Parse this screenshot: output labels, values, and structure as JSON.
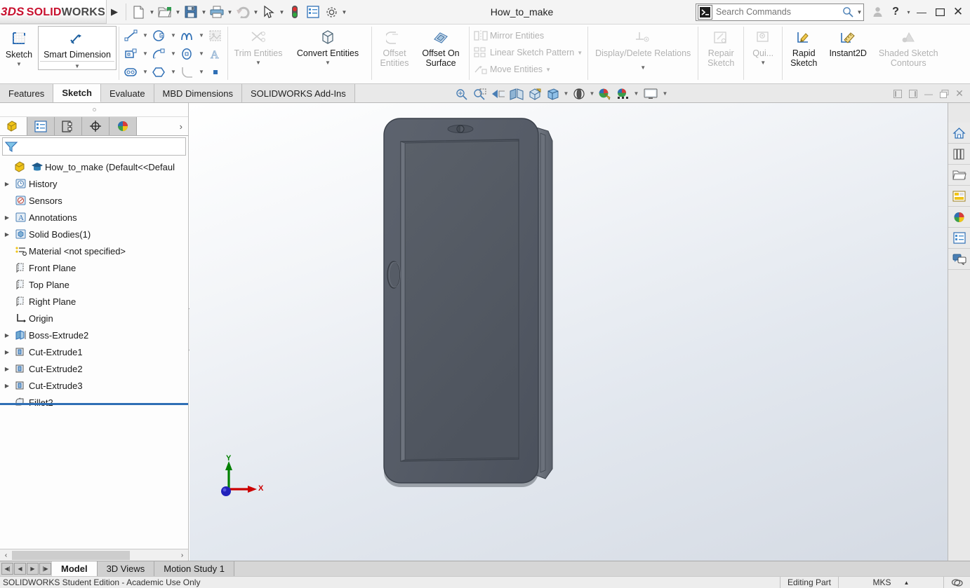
{
  "app": {
    "logo_3ds": "3DS",
    "logo_solid": "SOLID",
    "logo_works": "WORKS",
    "document_title": "How_to_make",
    "accent_red": "#c8102e",
    "accent_blue": "#2f6fb5"
  },
  "titlebar": {
    "menu_arrow": "▶",
    "tools": [
      {
        "name": "new-document",
        "icon": "new-doc-icon",
        "caret": true
      },
      {
        "name": "open-document",
        "icon": "open-folder-icon",
        "caret": true
      },
      {
        "name": "save-document",
        "icon": "save-disk-icon",
        "caret": true
      },
      {
        "name": "print-document",
        "icon": "printer-icon",
        "caret": true
      },
      {
        "name": "undo",
        "icon": "undo-arrow-icon",
        "caret": true
      },
      {
        "name": "select",
        "icon": "cursor-arrow-icon",
        "caret": true
      },
      {
        "name": "rebuild",
        "icon": "traffic-light-icon",
        "caret": false
      },
      {
        "name": "file-properties",
        "icon": "properties-list-icon",
        "caret": false
      },
      {
        "name": "options",
        "icon": "gear-icon",
        "caret": true
      }
    ],
    "search": {
      "placeholder": "Search Commands",
      "value": "",
      "badge_icon": "command-prompt-icon",
      "magnifier_icon": "search-icon",
      "caret_icon": "chevron-down-icon"
    },
    "account_icon": "user-icon",
    "help_label": "?",
    "help_caret": "▾",
    "minimize": "—",
    "maximize": "❐",
    "close": "✕"
  },
  "ribbon": {
    "groups": [
      {
        "name": "sketch-group",
        "buttons": [
          {
            "label": "Sketch",
            "icon": "sketch-icon",
            "enabled": true,
            "caret": true,
            "framed": false
          },
          {
            "label": "Smart Dimension",
            "icon": "smart-dimension-icon",
            "enabled": true,
            "caret": true,
            "framed": true
          }
        ]
      }
    ],
    "entity_grid": [
      [
        {
          "icon": "line-icon",
          "caret": true
        },
        {
          "icon": "circle-icon",
          "caret": true
        },
        {
          "icon": "spline-icon",
          "caret": true
        },
        {
          "icon": "sketch-picture-icon",
          "caret": false
        }
      ],
      [
        {
          "icon": "rectangle-icon",
          "caret": true
        },
        {
          "icon": "arc-icon",
          "caret": true
        },
        {
          "icon": "ellipse-icon",
          "caret": true
        },
        {
          "icon": "text-icon",
          "caret": false
        }
      ],
      [
        {
          "icon": "slot-icon",
          "caret": true
        },
        {
          "icon": "polygon-icon",
          "caret": true
        },
        {
          "icon": "fillet-icon",
          "caret": true
        },
        {
          "icon": "point-icon",
          "caret": false
        }
      ]
    ],
    "trim": {
      "label": "Trim Entities",
      "icon": "trim-entities-icon",
      "enabled": false,
      "caret": true
    },
    "convert": {
      "label": "Convert Entities",
      "icon": "convert-entities-icon",
      "enabled": true,
      "caret": true
    },
    "offset_entities": {
      "label_line1": "Offset",
      "label_line2": "Entities",
      "icon": "offset-entities-icon",
      "enabled": false
    },
    "offset_surface": {
      "label_line1": "Offset On",
      "label_line2": "Surface",
      "icon": "offset-on-surface-icon",
      "enabled": true
    },
    "pattern_rows": [
      {
        "label": "Mirror Entities",
        "icon": "mirror-entities-icon",
        "caret": false,
        "enabled": false
      },
      {
        "label": "Linear Sketch Pattern",
        "icon": "linear-sketch-pattern-icon",
        "caret": true,
        "enabled": false
      },
      {
        "label": "Move Entities",
        "icon": "move-entities-icon",
        "caret": true,
        "enabled": false
      }
    ],
    "relations": {
      "label": "Display/Delete Relations",
      "icon": "display-delete-relations-icon",
      "enabled": false,
      "caret": true
    },
    "repair": {
      "label_line1": "Repair",
      "label_line2": "Sketch",
      "icon": "repair-sketch-icon",
      "enabled": false
    },
    "quick_snaps": {
      "label": "Qui...",
      "icon": "quick-snaps-icon",
      "enabled": false,
      "caret": true
    },
    "rapid_sketch": {
      "label_line1": "Rapid",
      "label_line2": "Sketch",
      "icon": "rapid-sketch-icon",
      "enabled": true
    },
    "instant2d": {
      "label": "Instant2D",
      "icon": "instant2d-icon",
      "enabled": true
    },
    "shaded_contours": {
      "label_line1": "Shaded Sketch",
      "label_line2": "Contours",
      "icon": "shaded-sketch-contours-icon",
      "enabled": false
    }
  },
  "command_tabs": [
    {
      "label": "Features",
      "active": false
    },
    {
      "label": "Sketch",
      "active": true
    },
    {
      "label": "Evaluate",
      "active": false
    },
    {
      "label": "MBD Dimensions",
      "active": false
    },
    {
      "label": "SOLIDWORKS Add-Ins",
      "active": false
    }
  ],
  "view_toolbar": [
    {
      "name": "zoom-to-fit-icon",
      "caret": false
    },
    {
      "name": "zoom-to-area-icon",
      "caret": false
    },
    {
      "name": "previous-view-icon",
      "caret": false
    },
    {
      "name": "section-view-icon",
      "caret": false
    },
    {
      "name": "view-orientation-icon",
      "caret": false
    },
    {
      "name": "display-style-icon",
      "caret": true
    },
    {
      "name": "hide-show-items-icon",
      "caret": true
    },
    {
      "name": "edit-appearance-icon",
      "caret": false
    },
    {
      "name": "apply-scene-icon",
      "caret": true
    },
    {
      "name": "view-settings-icon",
      "caret": true
    }
  ],
  "doc_window_buttons": [
    {
      "name": "restore-left-icon",
      "glyph": "◀"
    },
    {
      "name": "restore-right-icon",
      "glyph": "▶"
    },
    {
      "name": "doc-minimize-icon",
      "glyph": "—"
    },
    {
      "name": "doc-restore-icon",
      "glyph": "❐"
    },
    {
      "name": "doc-close-icon",
      "glyph": "✕"
    }
  ],
  "left_panel": {
    "tabs": [
      {
        "name": "feature-manager-tab",
        "icon": "feature-tree-icon",
        "active": true
      },
      {
        "name": "property-manager-tab",
        "icon": "property-list-icon",
        "active": false
      },
      {
        "name": "configuration-manager-tab",
        "icon": "configuration-icon",
        "active": false
      },
      {
        "name": "dimxpert-manager-tab",
        "icon": "dimxpert-icon",
        "active": false
      },
      {
        "name": "display-manager-tab",
        "icon": "display-sphere-icon",
        "active": false
      }
    ],
    "more_glyph": "›",
    "filter": {
      "icon": "filter-funnel-icon",
      "placeholder": "",
      "value": ""
    },
    "tree": [
      {
        "label": "How_to_make  (Default<<Defaul",
        "icon": "part-icon",
        "expandable": false,
        "indent": 0,
        "root": true
      },
      {
        "label": "History",
        "icon": "history-icon",
        "expandable": true,
        "indent": 1
      },
      {
        "label": "Sensors",
        "icon": "sensors-icon",
        "expandable": false,
        "indent": 1
      },
      {
        "label": "Annotations",
        "icon": "annotations-icon",
        "expandable": true,
        "indent": 1
      },
      {
        "label": "Solid Bodies(1)",
        "icon": "solid-bodies-icon",
        "expandable": true,
        "indent": 1
      },
      {
        "label": "Material <not specified>",
        "icon": "material-icon",
        "expandable": false,
        "indent": 1
      },
      {
        "label": "Front Plane",
        "icon": "plane-icon",
        "expandable": false,
        "indent": 1
      },
      {
        "label": "Top Plane",
        "icon": "plane-icon",
        "expandable": false,
        "indent": 1
      },
      {
        "label": "Right Plane",
        "icon": "plane-icon",
        "expandable": false,
        "indent": 1
      },
      {
        "label": "Origin",
        "icon": "origin-icon",
        "expandable": false,
        "indent": 1
      },
      {
        "label": "Boss-Extrude2",
        "icon": "boss-extrude-icon",
        "expandable": true,
        "indent": 1
      },
      {
        "label": "Cut-Extrude1",
        "icon": "cut-extrude-icon",
        "expandable": true,
        "indent": 1
      },
      {
        "label": "Cut-Extrude2",
        "icon": "cut-extrude-icon",
        "expandable": true,
        "indent": 1
      },
      {
        "label": "Cut-Extrude3",
        "icon": "cut-extrude-icon",
        "expandable": true,
        "indent": 1
      },
      {
        "label": "Fillet2",
        "icon": "fillet-feature-icon",
        "expandable": false,
        "indent": 1
      }
    ],
    "hscroll": {
      "left_glyph": "‹",
      "right_glyph": "›"
    }
  },
  "graphics": {
    "triad": {
      "x_label": "X",
      "y_label": "Y",
      "x_color": "#cc0000",
      "y_color": "#008000",
      "z_color": "#0000cc"
    },
    "model_name": "tablet-device-model"
  },
  "task_pane": [
    {
      "name": "solidworks-resources-icon"
    },
    {
      "name": "design-library-icon"
    },
    {
      "name": "file-explorer-icon"
    },
    {
      "name": "view-palette-icon"
    },
    {
      "name": "appearances-scenes-icon"
    },
    {
      "name": "custom-properties-icon"
    },
    {
      "name": "solidworks-forum-icon"
    }
  ],
  "bottom": {
    "nav": [
      {
        "name": "first-tab-button",
        "glyph": "◀❘"
      },
      {
        "name": "prev-tab-button",
        "glyph": "◀"
      },
      {
        "name": "next-tab-button",
        "glyph": "▶"
      },
      {
        "name": "last-tab-button",
        "glyph": "❘▶"
      }
    ],
    "tabs": [
      {
        "label": "Model",
        "active": true
      },
      {
        "label": "3D Views",
        "active": false
      },
      {
        "label": "Motion Study 1",
        "active": false
      }
    ]
  },
  "status": {
    "license_text": "SOLIDWORKS Student Edition - Academic Use Only",
    "edit_mode": "Editing Part",
    "units": "MKS",
    "units_caret": "▲",
    "overlay_icon": "overlay-icon"
  }
}
